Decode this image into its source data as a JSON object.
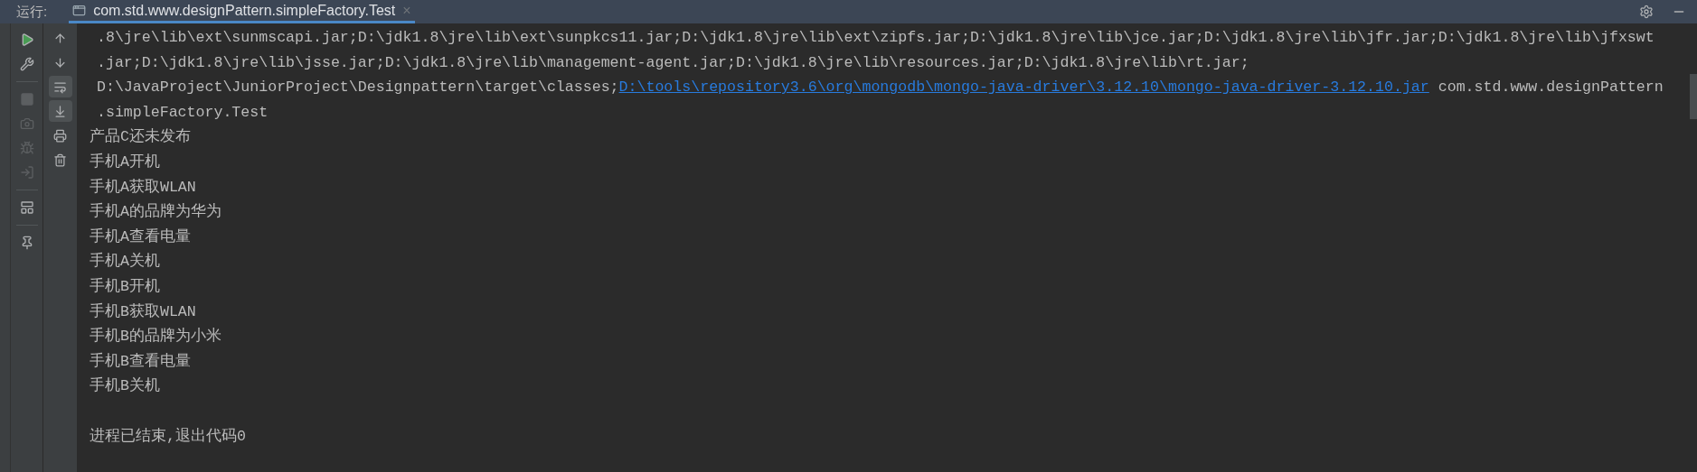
{
  "header": {
    "label": "运行:",
    "tab": {
      "title": "com.std.www.designPattern.simpleFactory.Test",
      "close": "×",
      "selected": true
    }
  },
  "toolbar_left": [
    {
      "kind": "run",
      "disabled": false
    },
    {
      "kind": "wrench",
      "disabled": false
    },
    {
      "kind": "divider"
    },
    {
      "kind": "stop",
      "disabled": true
    },
    {
      "kind": "camera",
      "disabled": true
    },
    {
      "kind": "bug",
      "disabled": true
    },
    {
      "kind": "exit",
      "disabled": true
    },
    {
      "kind": "divider"
    },
    {
      "kind": "layout",
      "disabled": false
    },
    {
      "kind": "divider"
    },
    {
      "kind": "pin",
      "disabled": false
    }
  ],
  "toolbar_right": [
    {
      "kind": "up",
      "selected": false
    },
    {
      "kind": "down",
      "selected": false
    },
    {
      "kind": "wrap",
      "selected": true
    },
    {
      "kind": "scroll-end",
      "selected": true
    },
    {
      "kind": "print",
      "selected": false
    },
    {
      "kind": "trash",
      "selected": false
    }
  ],
  "console": {
    "lines": [
      {
        "kind": "wrapped",
        "segments": [
          {
            "text": ".8\\jre\\lib\\ext\\sunmscapi.jar;D:\\jdk1.8\\jre\\lib\\ext\\sunpkcs11.jar;D:\\jdk1.8\\jre\\lib\\ext\\zipfs.jar;D:\\jdk1.8\\jre\\lib\\jce.jar;D:\\jdk1.8\\jre\\lib\\jfr.jar;D:\\jdk1.8\\jre\\lib\\jfxswt",
            "link": false
          }
        ]
      },
      {
        "kind": "wrapped",
        "segments": [
          {
            "text": ".jar;D:\\jdk1.8\\jre\\lib\\jsse.jar;D:\\jdk1.8\\jre\\lib\\management-agent.jar;D:\\jdk1.8\\jre\\lib\\resources.jar;D:\\jdk1.8\\jre\\lib\\rt.jar;",
            "link": false
          }
        ]
      },
      {
        "kind": "wrapped",
        "segments": [
          {
            "text": "D:\\JavaProject\\JuniorProject\\Designpattern\\target\\classes;",
            "link": false
          },
          {
            "text": "D:\\tools\\repository3.6\\org\\mongodb\\mongo-java-driver\\3.12.10\\mongo-java-driver-3.12.10.jar",
            "link": true
          },
          {
            "text": " com.std.www.designPattern",
            "link": false
          }
        ]
      },
      {
        "kind": "wrapped",
        "segments": [
          {
            "text": ".simpleFactory.Test",
            "link": false
          }
        ]
      },
      {
        "kind": "output",
        "segments": [
          {
            "text": "产品C还未发布",
            "link": false
          }
        ]
      },
      {
        "kind": "output",
        "segments": [
          {
            "text": "手机A开机",
            "link": false
          }
        ]
      },
      {
        "kind": "output",
        "segments": [
          {
            "text": "手机A获取WLAN",
            "link": false
          }
        ]
      },
      {
        "kind": "output",
        "segments": [
          {
            "text": "手机A的品牌为华为",
            "link": false
          }
        ]
      },
      {
        "kind": "output",
        "segments": [
          {
            "text": "手机A查看电量",
            "link": false
          }
        ]
      },
      {
        "kind": "output",
        "segments": [
          {
            "text": "手机A关机",
            "link": false
          }
        ]
      },
      {
        "kind": "output",
        "segments": [
          {
            "text": "手机B开机",
            "link": false
          }
        ]
      },
      {
        "kind": "output",
        "segments": [
          {
            "text": "手机B获取WLAN",
            "link": false
          }
        ]
      },
      {
        "kind": "output",
        "segments": [
          {
            "text": "手机B的品牌为小米",
            "link": false
          }
        ]
      },
      {
        "kind": "output",
        "segments": [
          {
            "text": "手机B查看电量",
            "link": false
          }
        ]
      },
      {
        "kind": "output",
        "segments": [
          {
            "text": "手机B关机",
            "link": false
          }
        ]
      },
      {
        "kind": "exit",
        "segments": [
          {
            "text": "进程已结束,退出代码0",
            "link": false
          }
        ]
      }
    ]
  }
}
